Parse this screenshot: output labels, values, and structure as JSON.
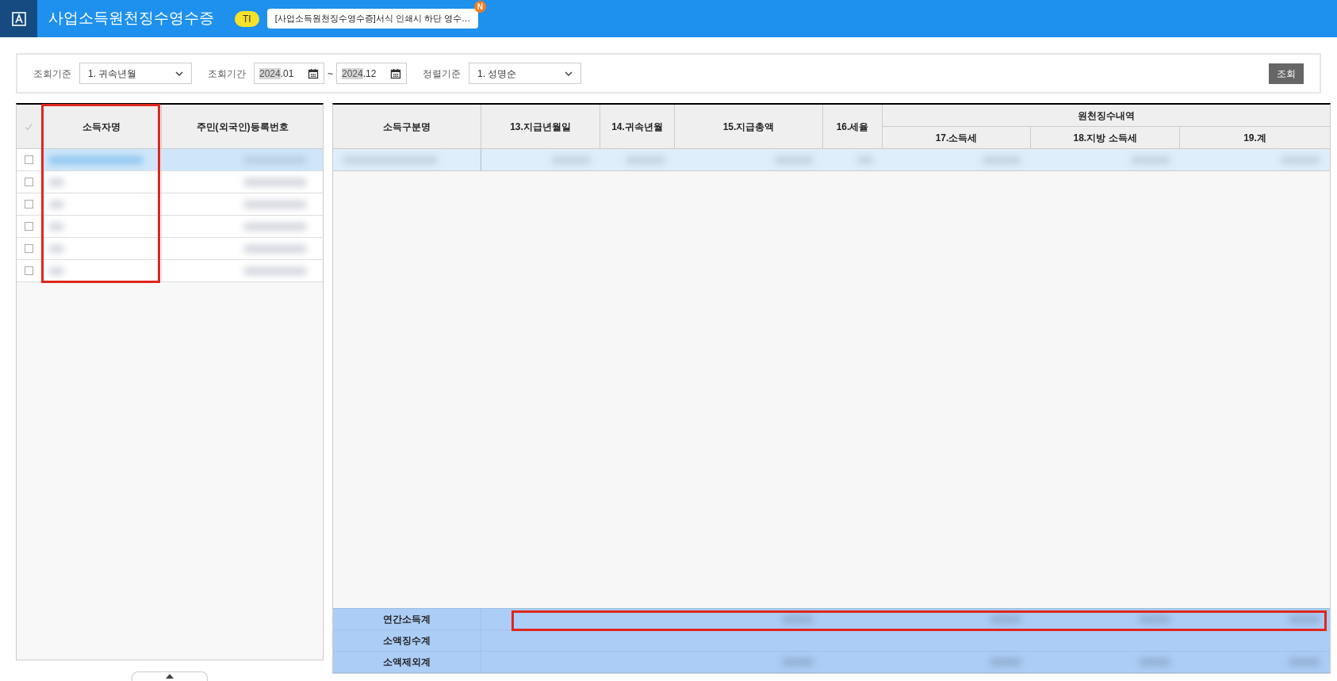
{
  "header": {
    "title": "사업소득원천징수영수증",
    "badge": "TI",
    "notice": "[사업소득원천징수영수증]서식 인쇄시 하단 영수…",
    "notice_badge": "N"
  },
  "filters": [
    {
      "kind": "select",
      "label": "조회기준",
      "value": "1. 귀속년월"
    },
    {
      "kind": "period",
      "label": "조회기간",
      "start": {
        "year": "2024",
        "month": ".01"
      },
      "separator": "~",
      "end": {
        "year": "2024",
        "month": ".12"
      }
    },
    {
      "kind": "select",
      "label": "정렬기준",
      "value": "1. 성명순"
    }
  ],
  "search_button": "조회",
  "left_grid": {
    "columns": [
      {
        "label": "소득자명",
        "highlighted": true
      },
      {
        "label": "주민(외국인)등록번호",
        "highlighted": false
      }
    ],
    "rows": [
      {
        "selected": true,
        "checked": false
      },
      {
        "selected": false,
        "checked": false
      },
      {
        "selected": false,
        "checked": false
      },
      {
        "selected": false,
        "checked": false
      },
      {
        "selected": false,
        "checked": false
      },
      {
        "selected": false,
        "checked": false
      }
    ]
  },
  "right_grid": {
    "columns": [
      "소득구분명",
      "13.지급년월일",
      "14.귀속년월",
      "15.지급총액",
      "16.세율"
    ],
    "group": {
      "label": "원천징수내역",
      "columns": [
        "17.소득세",
        "18.지방 소득세",
        "19.계"
      ]
    },
    "rows": [
      {
        "selected": true
      }
    ],
    "footer_rows": [
      {
        "label": "연간소득계",
        "highlighted": true
      },
      {
        "label": "소액징수계",
        "highlighted": false
      },
      {
        "label": "소액제외계",
        "highlighted": false
      }
    ]
  }
}
